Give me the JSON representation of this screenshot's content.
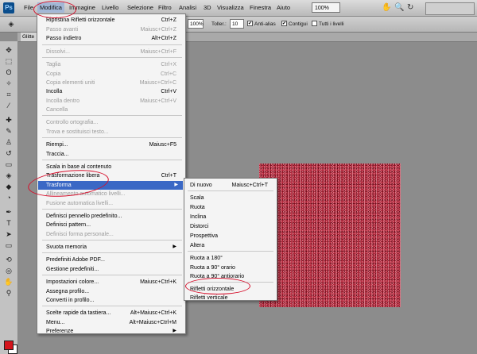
{
  "app_logo": "Ps",
  "menubar": {
    "items": [
      "File",
      "Modifica",
      "Immagine",
      "Livello",
      "Selezione",
      "Filtro",
      "Analisi",
      "3D",
      "Visualizza",
      "Finestra",
      "Aiuto"
    ],
    "zoom": "100%",
    "mode_button_1": "",
    "mode_button_2": ""
  },
  "options_bar": {
    "opacity_value": "100%",
    "tolerance_label": "Toller.:",
    "tolerance_value": "10",
    "antialias_label": "Anti-alias",
    "contiguous_label": "Contigui",
    "all_layers_label": "Tutti i livelli"
  },
  "document_tab": "Glitte",
  "modifica_menu": {
    "items": [
      {
        "label": "Ripristina Rifletti orizzontale",
        "shortcut": "Ctrl+Z"
      },
      {
        "label": "Passo avanti",
        "shortcut": "Maiusc+Ctrl+Z",
        "disabled": true
      },
      {
        "label": "Passo indietro",
        "shortcut": "Alt+Ctrl+Z"
      },
      {
        "label": "Dissolvi...",
        "shortcut": "Maiusc+Ctrl+F",
        "disabled": true
      },
      {
        "label": "Taglia",
        "shortcut": "Ctrl+X",
        "disabled": true
      },
      {
        "label": "Copia",
        "shortcut": "Ctrl+C",
        "disabled": true
      },
      {
        "label": "Copia elementi uniti",
        "shortcut": "Maiusc+Ctrl+C",
        "disabled": true
      },
      {
        "label": "Incolla",
        "shortcut": "Ctrl+V"
      },
      {
        "label": "Incolla dentro",
        "shortcut": "Maiusc+Ctrl+V",
        "disabled": true
      },
      {
        "label": "Cancella",
        "shortcut": "",
        "disabled": true
      },
      {
        "label": "Controllo ortografia...",
        "shortcut": "",
        "disabled": true
      },
      {
        "label": "Trova e sostituisci testo...",
        "shortcut": "",
        "disabled": true
      },
      {
        "label": "Riempi...",
        "shortcut": "Maiusc+F5"
      },
      {
        "label": "Traccia...",
        "shortcut": ""
      },
      {
        "label": "Scala in base al contenuto",
        "shortcut": ""
      },
      {
        "label": "Trasformazione libera",
        "shortcut": "Ctrl+T"
      },
      {
        "label": "Trasforma",
        "shortcut": "",
        "submenu": true,
        "highlight": true
      },
      {
        "label": "Allineamento automatico livelli...",
        "shortcut": "",
        "disabled": true
      },
      {
        "label": "Fusione automatica livelli...",
        "shortcut": "",
        "disabled": true
      },
      {
        "label": "Definisci pennello predefinito...",
        "shortcut": ""
      },
      {
        "label": "Definisci pattern...",
        "shortcut": ""
      },
      {
        "label": "Definisci forma personale...",
        "shortcut": "",
        "disabled": true
      },
      {
        "label": "Svuota memoria",
        "shortcut": "",
        "submenu": true
      },
      {
        "label": "Predefiniti Adobe PDF...",
        "shortcut": ""
      },
      {
        "label": "Gestione predefiniti...",
        "shortcut": ""
      },
      {
        "label": "Impostazioni colore...",
        "shortcut": "Maiusc+Ctrl+K"
      },
      {
        "label": "Assegna profilo...",
        "shortcut": ""
      },
      {
        "label": "Converti in profilo...",
        "shortcut": ""
      },
      {
        "label": "Scelte rapide da tastiera...",
        "shortcut": "Alt+Maiusc+Ctrl+K"
      },
      {
        "label": "Menu...",
        "shortcut": "Alt+Maiusc+Ctrl+M"
      },
      {
        "label": "Preferenze",
        "shortcut": "",
        "submenu": true
      }
    ]
  },
  "trasforma_submenu": {
    "items": [
      {
        "label": "Di nuovo",
        "shortcut": "Maiusc+Ctrl+T"
      },
      {
        "label": "Scala",
        "shortcut": ""
      },
      {
        "label": "Ruota",
        "shortcut": ""
      },
      {
        "label": "Inclina",
        "shortcut": ""
      },
      {
        "label": "Distorci",
        "shortcut": ""
      },
      {
        "label": "Prospettiva",
        "shortcut": ""
      },
      {
        "label": "Altera",
        "shortcut": ""
      },
      {
        "label": "Ruota a 180°",
        "shortcut": ""
      },
      {
        "label": "Ruota a 90° orario",
        "shortcut": ""
      },
      {
        "label": "Ruota a 90° antiorario",
        "shortcut": ""
      },
      {
        "label": "Rifletti orizzontale",
        "shortcut": ""
      },
      {
        "label": "Rifletti verticale",
        "shortcut": ""
      }
    ]
  },
  "colors": {
    "highlight": "#3a68c5",
    "annotation": "#d6102c",
    "foreground_swatch": "#d4141c",
    "canvas_red": "#b3263a"
  },
  "arrow_glyph": "▶",
  "checkmark": "✔",
  "icons": {
    "hand": "✋",
    "zoom": "🔍",
    "rotate": "↻"
  }
}
